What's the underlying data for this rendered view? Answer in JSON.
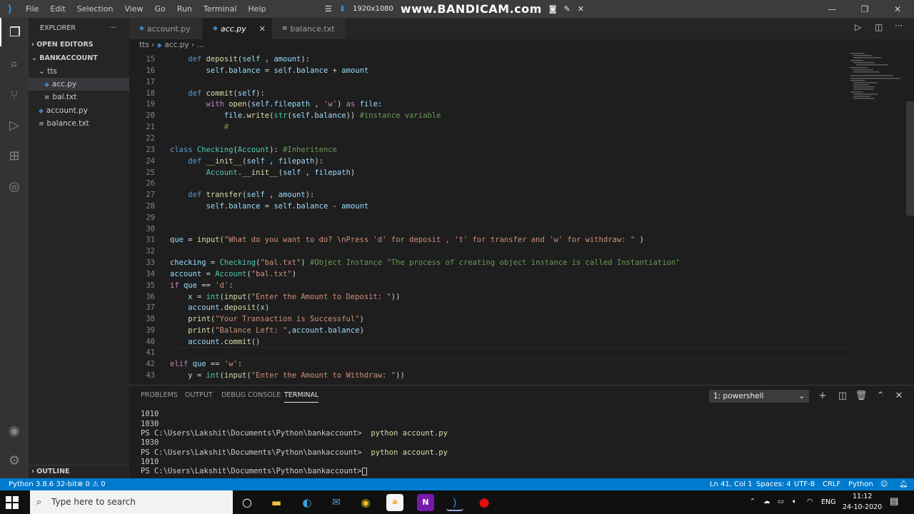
{
  "titlebar": {
    "menu": [
      "File",
      "Edit",
      "Selection",
      "View",
      "Go",
      "Run",
      "Terminal",
      "Help"
    ],
    "recording_res": "1920x1080",
    "brand": "www.BANDICAM.com"
  },
  "sidebar": {
    "title": "EXPLORER",
    "open_editors": "OPEN EDITORS",
    "project": "BANKACCOUNT",
    "folder": "tts",
    "files": [
      "acc.py",
      "bal.txt",
      "account.py",
      "balance.txt"
    ],
    "outline": "OUTLINE"
  },
  "tabs": [
    "account.py",
    "acc.py",
    "balance.txt"
  ],
  "breadcrumb": {
    "folder": "tts",
    "file": "acc.py",
    "rest": "..."
  },
  "editor": {
    "line_numbers": [
      "15",
      "16",
      "17",
      "18",
      "19",
      "20",
      "21",
      "22",
      "23",
      "24",
      "25",
      "26",
      "27",
      "28",
      "29",
      "30",
      "31",
      "32",
      "33",
      "34",
      "35",
      "36",
      "37",
      "38",
      "39",
      "40",
      "41",
      "42",
      "43"
    ]
  },
  "panel": {
    "tabs": [
      "PROBLEMS",
      "OUTPUT",
      "DEBUG CONSOLE",
      "TERMINAL"
    ],
    "shell": "1: powershell",
    "terminal_lines": [
      "1010",
      "1030"
    ],
    "prompt": "PS C:\\Users\\Lakshit\\Documents\\Python\\bankaccount>",
    "cmd": "python account.py",
    "out1": "1030",
    "out2": "1010"
  },
  "status": {
    "python": "Python 3.8.6 32-bit",
    "errors": "0",
    "warnings": "0",
    "position": "Ln 41, Col 1",
    "spaces": "Spaces: 4",
    "encoding": "UTF-8",
    "eol": "CRLF",
    "language": "Python"
  },
  "taskbar": {
    "search_placeholder": "Type here to search",
    "lang": "ENG",
    "time": "11:12",
    "date": "24-10-2020"
  }
}
